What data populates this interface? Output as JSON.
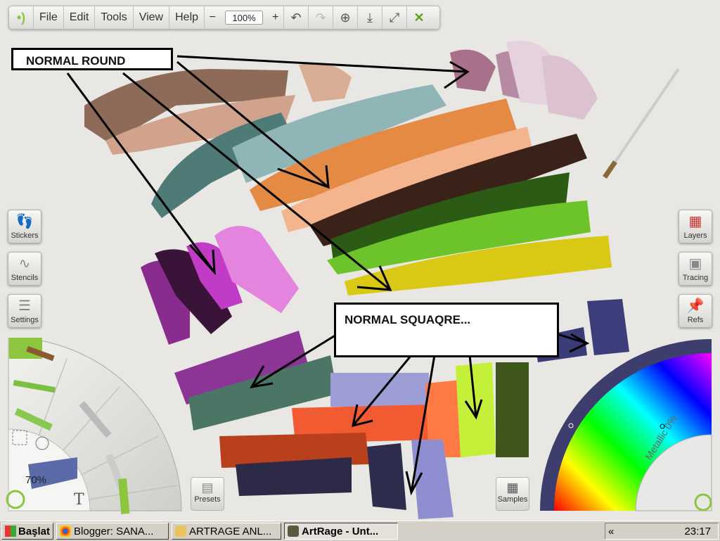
{
  "menubar": {
    "menus": [
      "File",
      "Edit",
      "Tools",
      "View",
      "Help"
    ],
    "zoom_minus": "−",
    "zoom_value": "100%",
    "zoom_plus": "+"
  },
  "left_panel": {
    "stickers": "Stickers",
    "stencils": "Stencils",
    "settings": "Settings"
  },
  "right_panel": {
    "layers": "Layers",
    "tracing": "Tracing",
    "refs": "Refs"
  },
  "canvas": {
    "label_round": "NORMAL ROUND",
    "label_square": "NORMAL SQUAQRE..."
  },
  "tool_wheel": {
    "opacity": "70%"
  },
  "color_wheel": {
    "metallic": "Metallic 0%"
  },
  "bottom_buttons": {
    "presets": "Presets",
    "samples": "Samples"
  },
  "taskbar": {
    "start": "Başlat",
    "tasks": [
      "Blogger: SANA...",
      "ARTRAGE ANL...",
      "ArtRage - Unt..."
    ],
    "tray_chevron": "«",
    "clock": "23:17"
  },
  "colors": {
    "accent_green": "#8cc63f",
    "canvas": "#e9e7e3"
  }
}
